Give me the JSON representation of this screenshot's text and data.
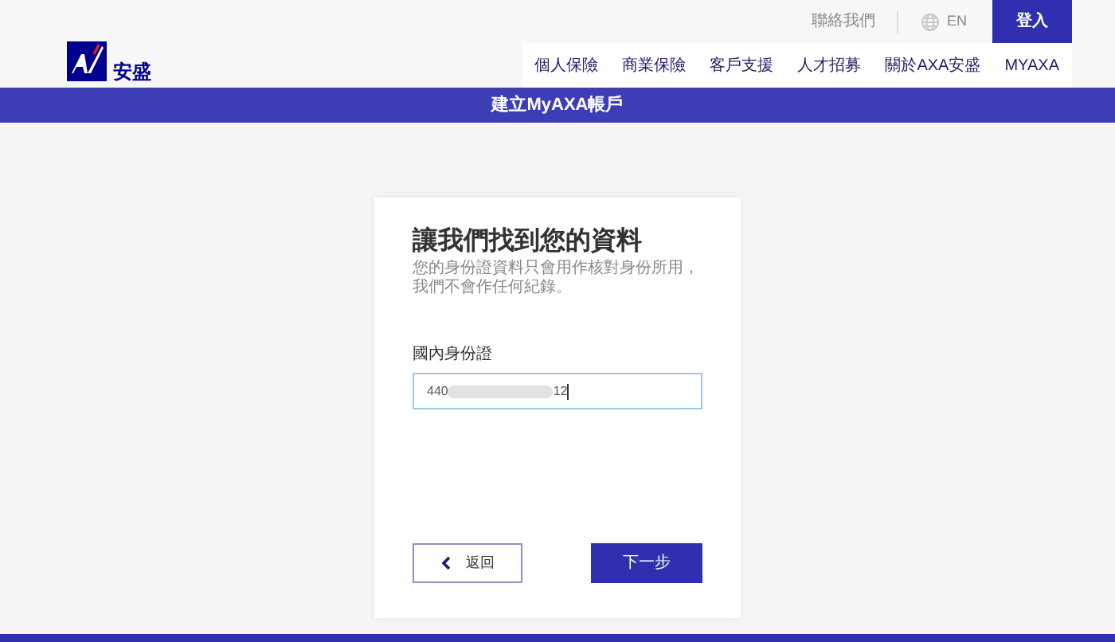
{
  "top_bar": {
    "contact": "聯絡我們",
    "language": "EN",
    "login": "登入"
  },
  "logo": {
    "name": "安盛"
  },
  "nav": [
    "個人保險",
    "商業保險",
    "客戶支援",
    "人才招募",
    "關於AXA安盛",
    "MYAXA"
  ],
  "banner": "建立MyAXA帳戶",
  "card": {
    "title": "讓我們找到您的資料",
    "subtitle": "您的身份證資料只會用作核對身份所用，我們不會作任何紀錄。",
    "field": {
      "label": "國內身份證",
      "value_start": "440",
      "value_end": "12",
      "redacted": true
    },
    "back": "返回",
    "next": "下一步"
  }
}
